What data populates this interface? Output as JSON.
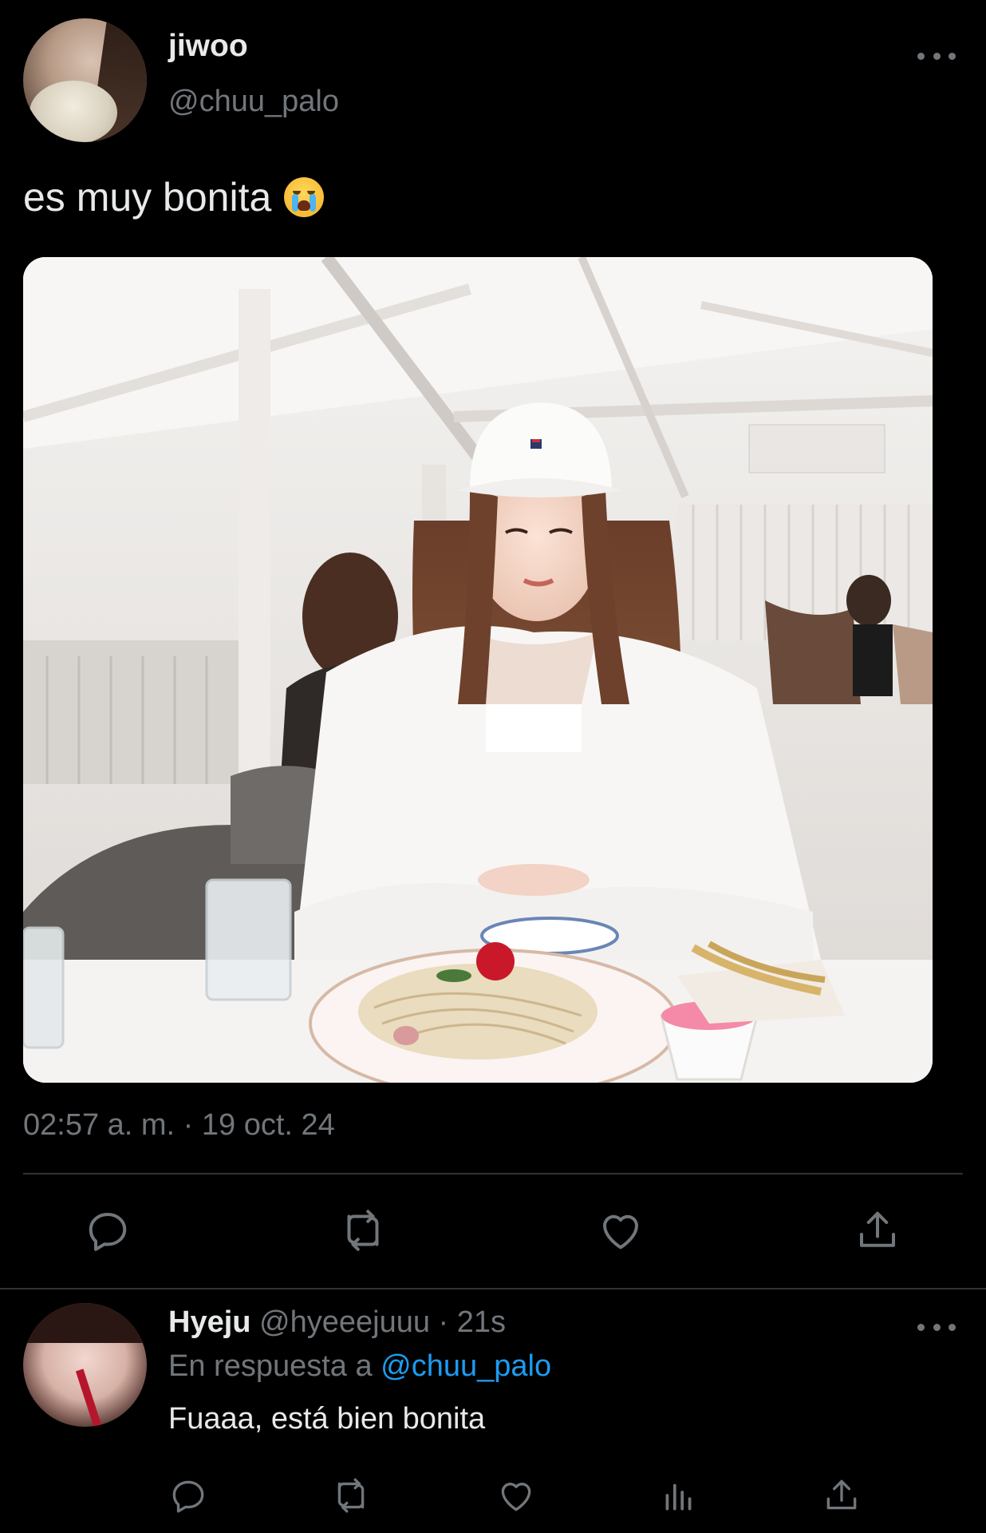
{
  "main_tweet": {
    "display_name": "jiwoo",
    "handle": "@chuu_palo",
    "text": "es muy bonita",
    "emoji": "loudly-crying-face",
    "timestamp": "02:57 a. m. · 19 oct. 24",
    "actions": [
      "reply-icon",
      "retweet-icon",
      "like-icon",
      "share-icon"
    ]
  },
  "reply": {
    "display_name": "Hyeju",
    "meta": "@hyeeejuuu · 21s",
    "reply_prefix": "En respuesta a",
    "reply_to": "@chuu_palo",
    "text": "Fuaaa, está bien bonita",
    "actions": [
      "reply-icon",
      "retweet-icon",
      "like-icon",
      "analytics-icon",
      "share-icon"
    ]
  },
  "colors": {
    "background": "#000000",
    "text_primary": "#e7e9ea",
    "text_secondary": "#71767b",
    "link": "#1d9bf0",
    "divider": "#2f3336"
  }
}
